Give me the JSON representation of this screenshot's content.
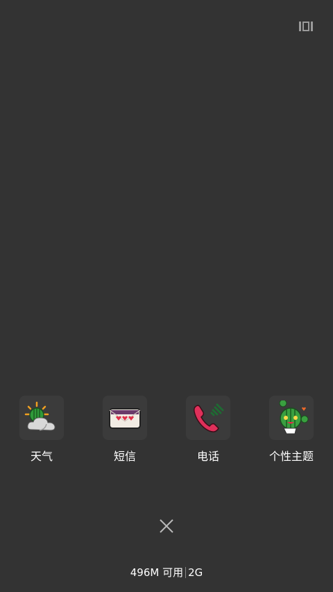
{
  "top_bar": {
    "layout_icon": "recent-layout-icon"
  },
  "apps": [
    {
      "label": "天气",
      "icon": "weather-icon"
    },
    {
      "label": "短信",
      "icon": "messages-icon"
    },
    {
      "label": "电话",
      "icon": "phone-icon"
    },
    {
      "label": "个性主题",
      "icon": "themes-icon"
    }
  ],
  "close": {
    "icon": "close-icon"
  },
  "memory": {
    "available": "496M 可用",
    "total": "2G"
  },
  "colors": {
    "background": "#333333",
    "tile": "#3b3b3b",
    "text": "#ffffff"
  }
}
